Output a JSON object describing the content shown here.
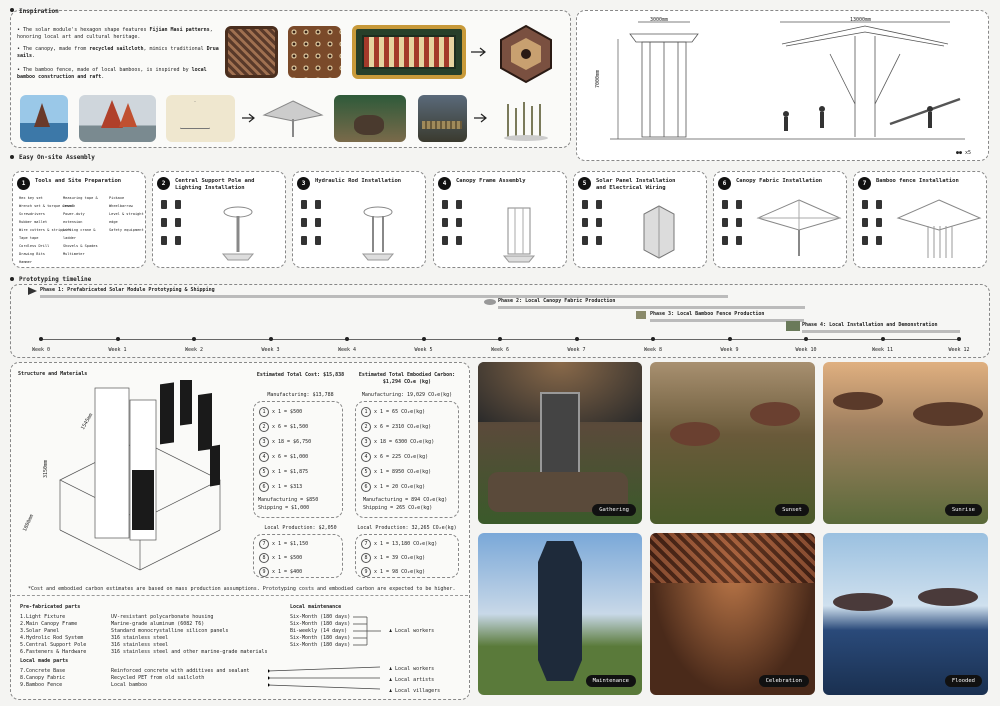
{
  "inspiration": {
    "title": "Inspiration",
    "bullets": [
      [
        "The solar module's hexagon shape features ",
        "Fijian Masi patterns",
        ", honoring local art and cultural heritage."
      ],
      [
        "The canopy, made from ",
        "recycled sailcloth",
        ", mimics traditional ",
        "Drua sails",
        "."
      ],
      [
        "The bamboo fence, made of local bamboos, is inspired by ",
        "local bamboo construction and raft",
        "."
      ]
    ]
  },
  "elevation": {
    "dim1": "3000mm",
    "dim2": "13000mm",
    "height": "7000mm",
    "people": "x5"
  },
  "assembly": {
    "title": "Easy On-site Assembly",
    "steps": [
      {
        "n": "1",
        "title": "Tools and Site Preparation"
      },
      {
        "n": "2",
        "title": "Central Support Pole and Lighting Installation"
      },
      {
        "n": "3",
        "title": "Hydraulic Rod Installation"
      },
      {
        "n": "4",
        "title": "Canopy Frame Assembly"
      },
      {
        "n": "5",
        "title": "Solar Panel Installation and Electrical Wiring"
      },
      {
        "n": "6",
        "title": "Canopy Fabric Installation"
      },
      {
        "n": "7",
        "title": "Bamboo fence Installation"
      }
    ],
    "tools": [
      "Hex key set",
      "Wrench set & torque wrench",
      "Screwdrivers",
      "Rubber mallet",
      "Wire cutters & strippers",
      "Tape tape",
      "Cordless Drill",
      "Drawing Bits",
      "Hammer",
      "Measuring tape & level",
      "Power-duty extension",
      "Lifting crane & ladder",
      "Shovels & Spades",
      "Multimeter",
      "Pickaxe",
      "Wheelbarrow",
      "Level & straight edge",
      "Safety equipment"
    ]
  },
  "timeline": {
    "title": "Prototyping timeline",
    "phases": [
      "Phase 1: Prefabricated Solar Module Prototyping & Shipping",
      "Phase 2: Local Canopy Fabric Production",
      "Phase 3: Local Bamboo Fence Production",
      "Phase 4: Local Installation and Demonstration"
    ],
    "weeks": [
      "Week 0",
      "Week 1",
      "Week 2",
      "Week 3",
      "Week 4",
      "Week 5",
      "Week 6",
      "Week 7",
      "Week 8",
      "Week 9",
      "Week 10",
      "Week 11",
      "Week 12"
    ]
  },
  "structure": {
    "title": "Structure and Materials",
    "dims": [
      "1800mm",
      "3150mm",
      "1545mm"
    ],
    "cost_title": "Estimated Total Cost: $15,838",
    "carbon_title": "Estimated Total Embodied Carbon: $1,294 CO₂e (kg)",
    "cost_manu": "Manufacturing: $13,788",
    "carbon_manu": "Manufacturing: 19,029 CO₂e(kg)",
    "cost_lines": [
      "x 1 = $500",
      "x 6 = $1,500",
      "x 18 = $6,750",
      "x 6 = $1,000",
      "x 1 = $1,875",
      "x 1 = $313"
    ],
    "cost_extra": [
      "Manufacturing = $850",
      "Shipping = $1,000"
    ],
    "carbon_lines": [
      "x 1 = 65 CO₂e(kg)",
      "x 6 = 2310 CO₂e(kg)",
      "x 18 = 6300 CO₂e(kg)",
      "x 6 = 225 CO₂e(kg)",
      "x 1 = 8950 CO₂e(kg)",
      "x 1 = 20 CO₂e(kg)"
    ],
    "carbon_extra": [
      "Manufacturing = 894 CO₂e(kg)",
      "Shipping = 265 CO₂e(kg)"
    ],
    "cost_local": "Local Production: $2,050",
    "carbon_local": "Local Production: 32,265 CO₂e(kg)",
    "cost_local_lines": [
      "x 1 = $1,150",
      "x 1 = $500",
      "x 1 = $400"
    ],
    "carbon_local_lines": [
      "x 1 = 13,180 CO₂e(kg)",
      "x 1 = 39 CO₂e(kg)",
      "x 1 = 98 CO₂e(kg)"
    ],
    "footnote": "*Cost and embodied carbon estimates are based on mass production assumptions. Prototyping costs and embodied carbon are expected to be higher."
  },
  "parts": {
    "prefab_title": "Pre-fabricated parts",
    "prefab": [
      [
        "1.Light Fixture",
        "UV-resistant polycarbonate housing"
      ],
      [
        "2.Main Canopy Frame",
        "Marine-grade aluminum (6082 T6)"
      ],
      [
        "3.Solar Panel",
        "Standard monocrystalline silicon panels"
      ],
      [
        "4.Hydrolic Rod System",
        "316 stainless steel"
      ],
      [
        "5.Central Support Pole",
        "316 stainless steel"
      ],
      [
        "6.Fasteners & Hardware",
        "316 stainless steel and other marine-grade materials"
      ]
    ],
    "maint_title": "Local maintenance",
    "maint": [
      "Six-Month (180 days)",
      "Six-Month (180 days)",
      "Bi-weekly (14 days)",
      "Six-Month (180 days)",
      "Six-Month (180 days)"
    ],
    "local_title": "Local made parts",
    "local": [
      [
        "7.Concrete Base",
        "Reinforced concrete with additives and sealant"
      ],
      [
        "8.Canopy Fabric",
        "Recycled PET from old sailcloth"
      ],
      [
        "9.Bamboo Fence",
        "Local bamboo"
      ]
    ],
    "workers": "Local workers",
    "roles": [
      "Local workers",
      "Local artists",
      "Local villagers"
    ]
  },
  "renders": [
    "Gathering",
    "Sunset",
    "Sunrise",
    "Maintenance",
    "Celebration",
    "Flooded"
  ]
}
